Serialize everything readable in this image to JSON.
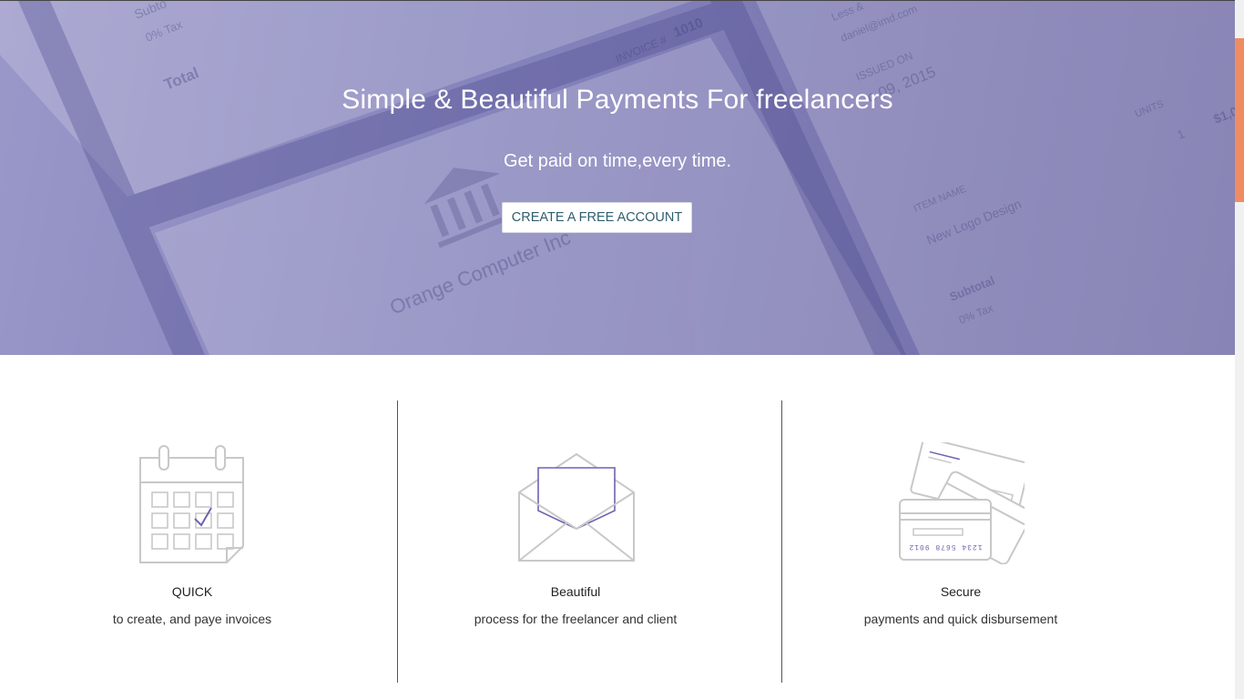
{
  "hero": {
    "title": "Simple & Beautiful Payments For freelancers",
    "subtitle": "Get paid on time,every time.",
    "cta_label": "CREATE A FREE ACCOUNT",
    "background_text": {
      "total": "Total",
      "subtotal_top": "Subto",
      "tax_top": "0% Tax",
      "invoice_label": "INVOICE #",
      "invoice_number": "1010",
      "issued_on": "ISSUED ON",
      "issued_date": "c 09, 2015",
      "email": "daniel@imd.com",
      "email_label": "Less &",
      "units_label": "UNITS",
      "units_value": "1",
      "amount": "$1,0",
      "item_name_label": "ITEM NAME",
      "item_name": "New Logo Design",
      "company": "Orange Computer Inc",
      "subtotal": "Subtotal",
      "tax": "0% Tax"
    }
  },
  "features": [
    {
      "icon": "calendar-check-icon",
      "title": "QUICK",
      "description": "to create, and paye invoices"
    },
    {
      "icon": "envelope-letter-icon",
      "title": "Beautiful",
      "description": "process for the freelancer and client"
    },
    {
      "icon": "credit-cards-icon",
      "title": "Secure",
      "description": "payments and quick disbursement",
      "card_number": "1234 5678 9012"
    }
  ],
  "colors": {
    "hero_start": "#9a97c9",
    "hero_end": "#6f6aa6",
    "accent_purple": "#6c63b0",
    "scroll_thumb": "#f08c63",
    "icon_gray": "#c8c8c8"
  }
}
